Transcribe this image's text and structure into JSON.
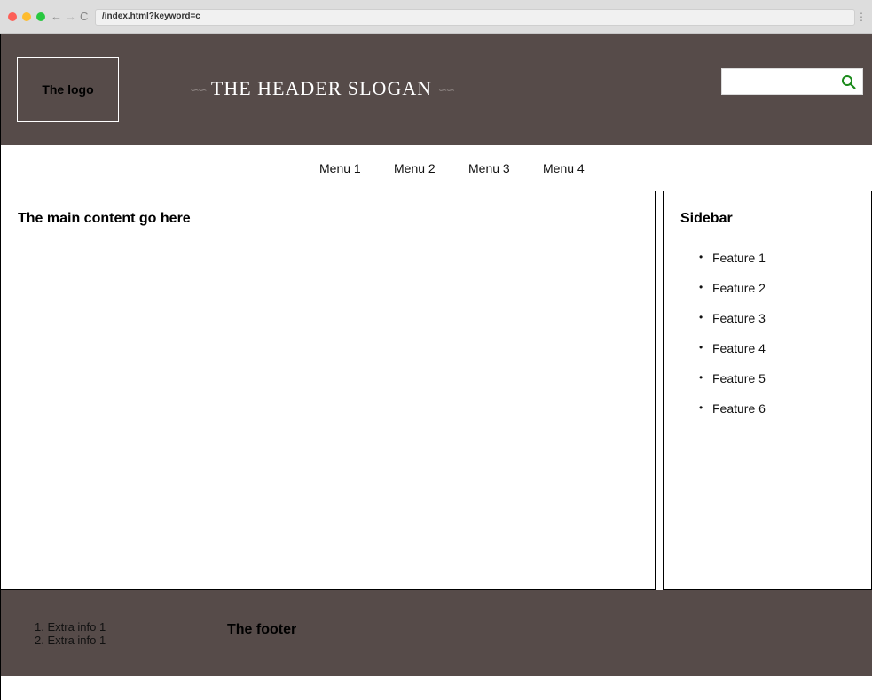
{
  "browser": {
    "url": "/index.html?keyword=c",
    "back_icon": "←",
    "forward_icon": "→",
    "reload_icon": "C",
    "menu_icon": "⋮"
  },
  "header": {
    "logo_text": "The logo",
    "slogan": "THE HEADER SLOGAN",
    "flourish": "∽∽",
    "search": {
      "value": "",
      "placeholder": "",
      "icon": "search-icon",
      "icon_color": "#1a8a1a"
    },
    "background": "#564b49"
  },
  "menu": {
    "items": [
      {
        "label": "Menu 1"
      },
      {
        "label": "Menu 2"
      },
      {
        "label": "Menu 3"
      },
      {
        "label": "Menu 4"
      }
    ]
  },
  "main": {
    "title": "The main content go here"
  },
  "sidebar": {
    "title": "Sidebar",
    "features": [
      {
        "label": "Feature 1"
      },
      {
        "label": "Feature 2"
      },
      {
        "label": "Feature 3"
      },
      {
        "label": "Feature 4"
      },
      {
        "label": "Feature 5"
      },
      {
        "label": "Feature 6"
      }
    ]
  },
  "footer": {
    "extra_info": [
      {
        "label": "1. Extra info 1"
      },
      {
        "label": "2. Extra info 1"
      }
    ],
    "title": "The footer",
    "background": "#564b49"
  }
}
